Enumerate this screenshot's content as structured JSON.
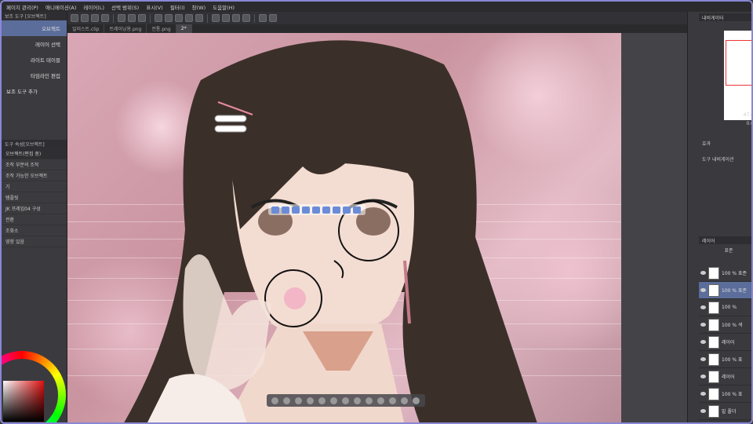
{
  "menu": [
    "페이지 관리(P)",
    "애니메이션(A)",
    "레이어(L)",
    "선택 범위(S)",
    "표시(V)",
    "필터(I)",
    "창(W)",
    "도움말(H)"
  ],
  "tabs": [
    "일러스트.clip",
    "트레이닝용.png",
    "전통.png",
    "2*"
  ],
  "left_panel": {
    "header": "보조 도구 [오브젝트]",
    "items": [
      "오브젝트",
      "레이어 선택",
      "라이트 테이블",
      "타임라인 편집"
    ],
    "add_tool": "보조 도구 추가",
    "detail_header": "도구 속성[오브젝트]",
    "detail_rows": [
      "오브젝트(편집 중)",
      "조작 부분의 조작",
      "조작 가능한 오브젝트",
      "기",
      "템플릿",
      "JK 프레임04 구성",
      "전환",
      "조화소",
      "영향 있음"
    ]
  },
  "right_panel": {
    "nav_header": "내비게이터",
    "zoom": "47.8",
    "rotation": "0.0",
    "section_effect": "효과",
    "section_tool_nav": "도구 내비게이션",
    "layer_header": "레이어",
    "blend": "표준",
    "layers": [
      {
        "name": "100 % 표준",
        "thumb": "white"
      },
      {
        "name": "100 % 표준",
        "thumb": "white"
      },
      {
        "name": "100 %",
        "thumb": "white"
      },
      {
        "name": "100 % 색",
        "thumb": "white"
      },
      {
        "name": "레이어",
        "thumb": "white"
      },
      {
        "name": "100 % 표",
        "thumb": "white"
      },
      {
        "name": "레이어",
        "thumb": "white"
      },
      {
        "name": "100 % 표",
        "thumb": "white"
      },
      {
        "name": "밑 폴더",
        "thumb": "white"
      },
      {
        "name": "레이어",
        "thumb": "white"
      }
    ]
  },
  "colors": {
    "accent": "#8a87d6",
    "selection": "#5b6d9a",
    "ui_dark": "#3b3b3f",
    "sakura": "#e3b7c4",
    "hair": "#3b3029"
  }
}
